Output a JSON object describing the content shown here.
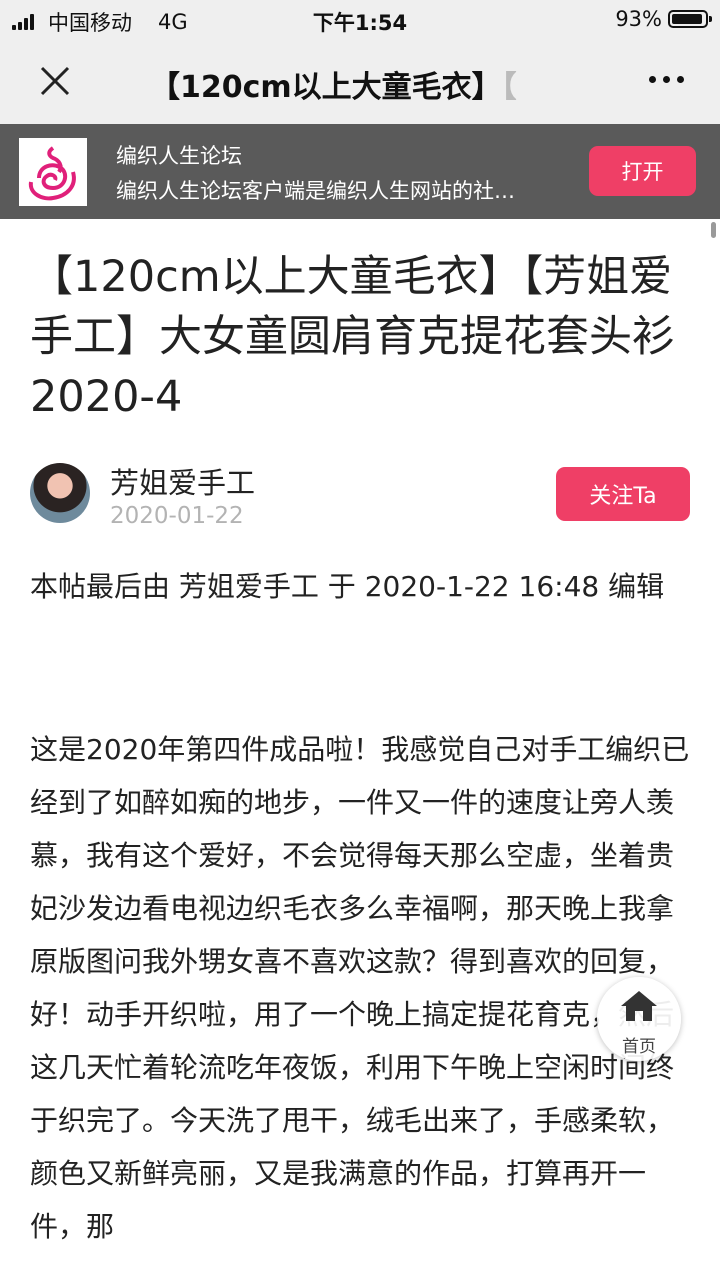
{
  "status_bar": {
    "carrier": "中国移动",
    "network": "4G",
    "time": "下午1:54",
    "battery": "93%",
    "battery_level": 0.93
  },
  "nav": {
    "title": "【120cm以上大童毛衣】",
    "title_overflow": "【"
  },
  "app_banner": {
    "name": "编织人生论坛",
    "description": "编织人生论坛客户端是编织人生网站的社…",
    "open_label": "打开",
    "accent_color": "#ef3f66"
  },
  "article": {
    "title": "【120cm以上大童毛衣】【芳姐爱手工】大女童圆肩育克提花套头衫2020-4",
    "author": "芳姐爱手工",
    "date": "2020-01-22",
    "follow_label": "关注Ta",
    "edit_note": "本帖最后由 芳姐爱手工 于 2020-1-22 16:48 编辑",
    "body": "这是2020年第四件成品啦！我感觉自己对手工编织已经到了如醉如痴的地步，一件又一件的速度让旁人羡慕，我有这个爱好，不会觉得每天那么空虚，坐着贵妃沙发边看电视边织毛衣多么幸福啊，那天晚上我拿原版图问我外甥女喜不喜欢这款？得到喜欢的回复，好！动手开织啦，用了一个晚上搞定提花育克，然后这几天忙着轮流吃年夜饭，利用下午晚上空闲时间终于织完了。今天洗了甩干，绒毛出来了，手感柔软，颜色又新鲜亮丽，又是我满意的作品，打算再开一件，那"
  },
  "home_button": {
    "label": "首页",
    "icon": "home-icon"
  }
}
